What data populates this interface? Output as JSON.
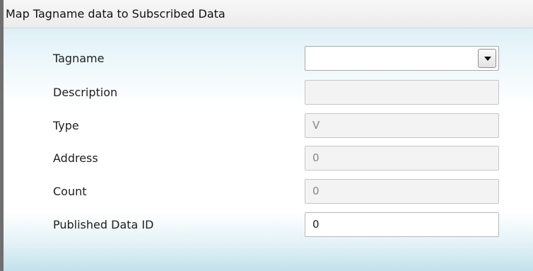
{
  "window": {
    "title": "Map Tagname data to Subscribed Data"
  },
  "form": {
    "tagname": {
      "label": "Tagname",
      "value": ""
    },
    "description": {
      "label": "Description",
      "value": ""
    },
    "type": {
      "label": "Type",
      "value": "V"
    },
    "address": {
      "label": "Address",
      "value": "0"
    },
    "count": {
      "label": "Count",
      "value": "0"
    },
    "published_data_id": {
      "label": "Published Data ID",
      "value": "0"
    }
  },
  "icons": {
    "dropdown": "chevron-down-icon"
  }
}
